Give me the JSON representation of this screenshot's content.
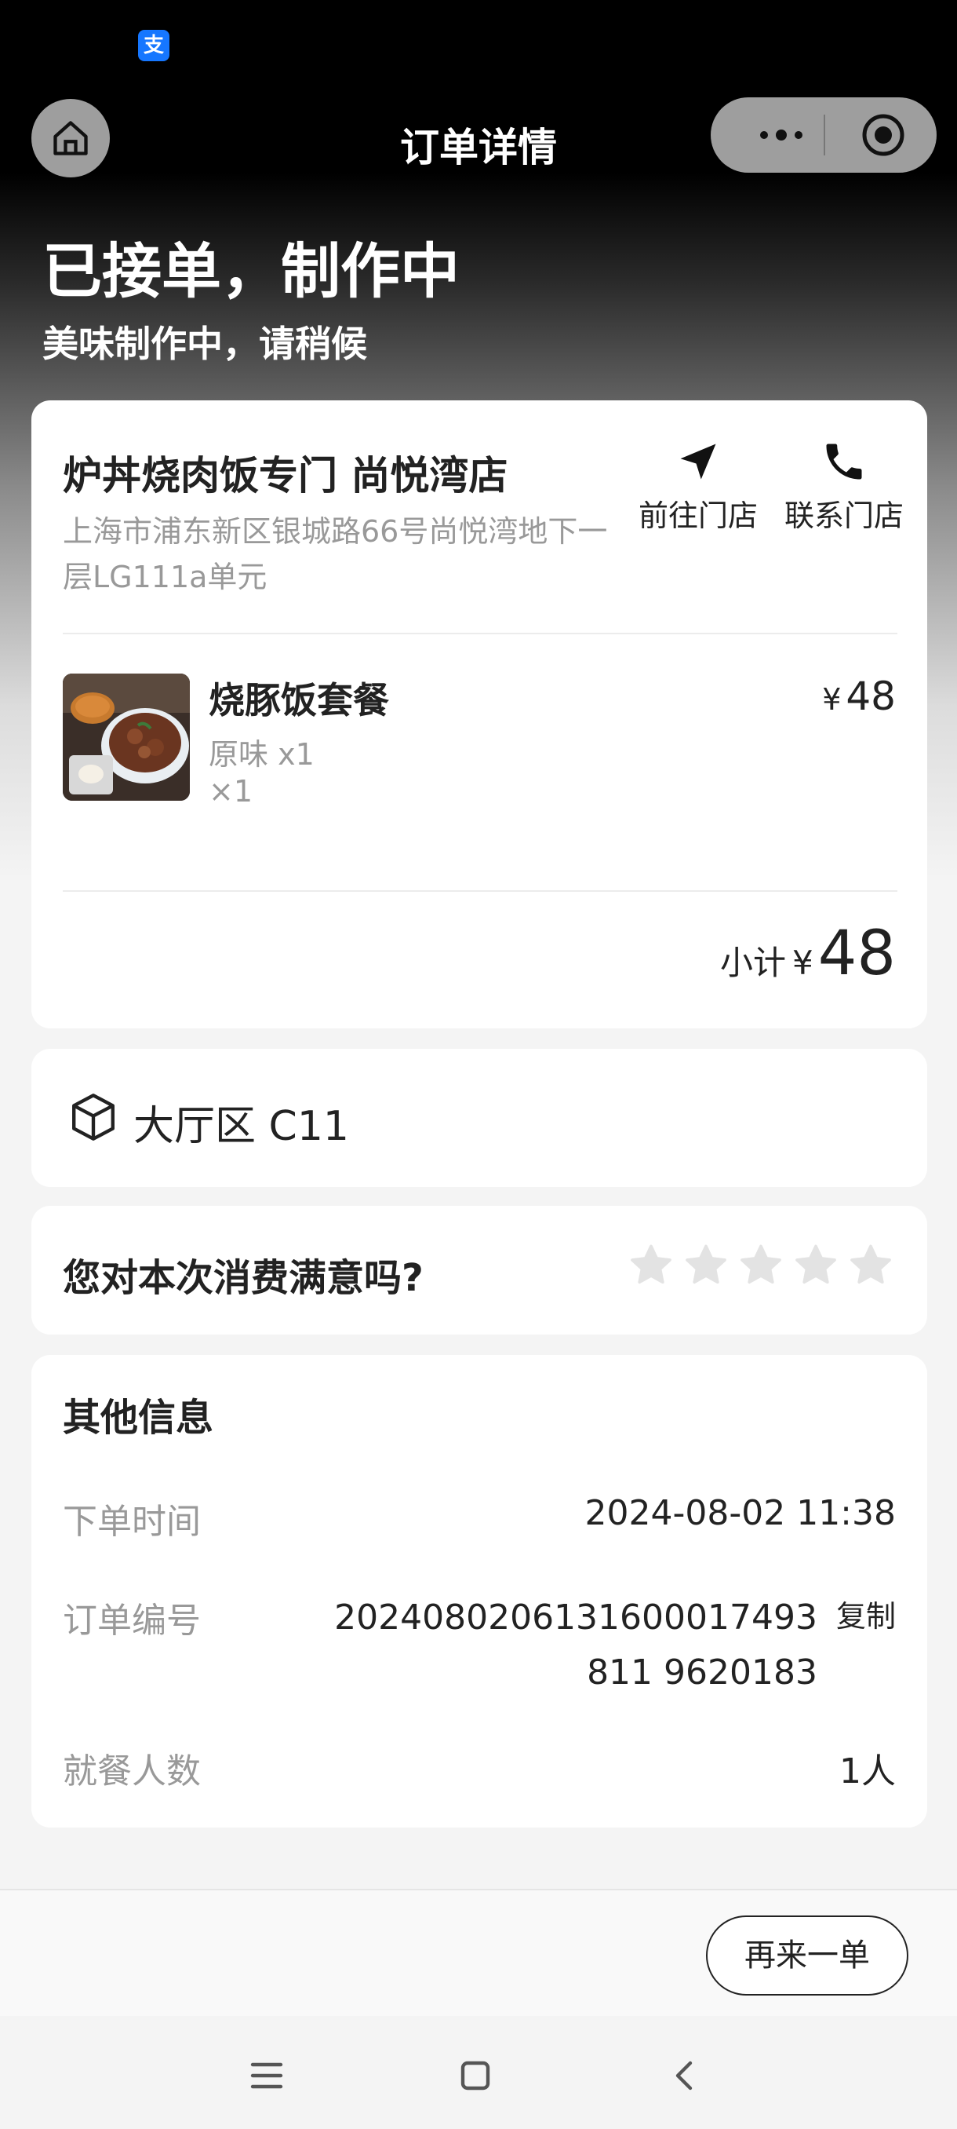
{
  "app": {
    "status_icon_label": "支"
  },
  "nav": {
    "title": "订单详情"
  },
  "order_status": {
    "title": "已接单，制作中",
    "subtitle": "美味制作中，请稍候"
  },
  "store": {
    "name": "炉丼烧肉饭专门 尚悦湾店",
    "address": "上海市浦东新区银城路66号尚悦湾地下一层LG111a单元",
    "go_label": "前往门店",
    "call_label": "联系门店"
  },
  "item": {
    "name": "烧豚饭套餐",
    "spec": "原味 x1",
    "qty": "×1",
    "currency": "¥",
    "price": "48"
  },
  "subtotal": {
    "label": "小计",
    "currency": "¥",
    "amount": "48"
  },
  "table": {
    "text": "大厅区 C11"
  },
  "rating": {
    "question": "您对本次消费满意吗?",
    "stars": 0,
    "max_stars": 5
  },
  "other_info": {
    "title": "其他信息",
    "order_time_label": "下单时间",
    "order_time": "2024-08-02 11:38",
    "order_no_label": "订单编号",
    "order_no": "2024080206131600017493811 9620183",
    "copy_label": "复制",
    "diners_label": "就餐人数",
    "diners": "1人"
  },
  "footer": {
    "reorder_label": "再来一单"
  },
  "icons": {
    "home": "home-icon",
    "more": "more-dots-icon",
    "target": "target-icon",
    "go": "navigation-arrow-icon",
    "call": "phone-icon",
    "table": "cube-icon",
    "star": "star-icon",
    "menu": "menu-icon",
    "square": "square-icon",
    "back": "back-icon"
  }
}
